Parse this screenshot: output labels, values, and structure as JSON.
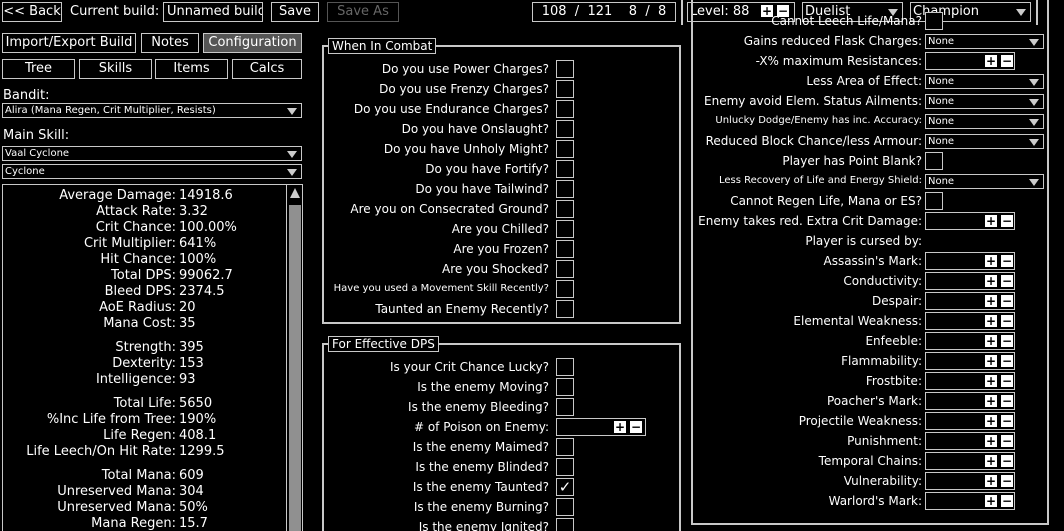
{
  "topbar": {
    "back": "<< Back",
    "current_build_label": "Current build:",
    "build_name": "Unnamed build",
    "save": "Save",
    "save_as": "Save As",
    "points": "108  /  121    8  /  8",
    "level": "Level: 88",
    "class": "Duelist",
    "ascendancy": "Champion"
  },
  "left": {
    "tabs": [
      "Import/Export Build",
      "Notes",
      "Configuration"
    ],
    "subtabs": [
      "Tree",
      "Skills",
      "Items",
      "Calcs"
    ],
    "bandit_label": "Bandit:",
    "bandit_value": "Alira (Mana Regen, Crit Multiplier, Resists)",
    "main_skill_label": "Main Skill:",
    "main_skill": "Vaal Cyclone",
    "sub_skill": "Cyclone",
    "stats": [
      {
        "k": "Average Damage:",
        "v": "14918.6"
      },
      {
        "k": "Attack Rate:",
        "v": "3.32"
      },
      {
        "k": "Crit Chance:",
        "v": "100.00%"
      },
      {
        "k": "Crit Multiplier:",
        "v": "641%"
      },
      {
        "k": "Hit Chance:",
        "v": "100%"
      },
      {
        "k": "Total DPS:",
        "v": "99062.7"
      },
      {
        "k": "Bleed DPS:",
        "v": "2374.5"
      },
      {
        "k": "AoE Radius:",
        "v": "20"
      },
      {
        "k": "Mana Cost:",
        "v": "35"
      },
      {
        "k": "Strength:",
        "v": "395"
      },
      {
        "k": "Dexterity:",
        "v": "153"
      },
      {
        "k": "Intelligence:",
        "v": "93"
      },
      {
        "k": "Total Life:",
        "v": "5650"
      },
      {
        "k": "%Inc Life from Tree:",
        "v": "190%"
      },
      {
        "k": "Life Regen:",
        "v": "408.1"
      },
      {
        "k": "Life Leech/On Hit Rate:",
        "v": "1299.5"
      },
      {
        "k": "Total Mana:",
        "v": "609"
      },
      {
        "k": "Unreserved Mana:",
        "v": "304"
      },
      {
        "k": "Unreserved Mana:",
        "v": "50%"
      },
      {
        "k": "Mana Regen:",
        "v": "15.7"
      }
    ]
  },
  "combat": {
    "title": "When In Combat",
    "items": [
      "Do you use Power Charges?",
      "Do you use Frenzy Charges?",
      "Do you use Endurance Charges?",
      "Do you have Onslaught?",
      "Do you have Unholy Might?",
      "Do you have Fortify?",
      "Do you have Tailwind?",
      "Are you on Consecrated Ground?",
      "Are you Chilled?",
      "Are you Frozen?",
      "Are you Shocked?",
      "Have you used a Movement Skill Recently?",
      "Taunted an Enemy Recently?"
    ]
  },
  "dps": {
    "title": "For Effective DPS",
    "items": [
      "Is your Crit Chance Lucky?",
      "Is the enemy Moving?",
      "Is the enemy Bleeding?",
      "# of Poison on Enemy:",
      "Is the enemy Maimed?",
      "Is the enemy Blinded?",
      "Is the enemy Taunted?",
      "Is the enemy Burning?",
      "Is the enemy Ignited?"
    ],
    "taunted_check": "✓"
  },
  "right": {
    "items": [
      {
        "label": "Cannot Leech Life/Mana?",
        "type": "cb"
      },
      {
        "label": "Gains reduced Flask Charges:",
        "type": "dd",
        "value": "None"
      },
      {
        "label": "-X% maximum Resistances:",
        "type": "num"
      },
      {
        "label": "Less Area of Effect:",
        "type": "dd",
        "value": "None"
      },
      {
        "label": "Enemy avoid Elem. Status Ailments:",
        "type": "dd",
        "value": "None"
      },
      {
        "label": "Unlucky Dodge/Enemy has inc. Accuracy:",
        "type": "dd",
        "value": "None",
        "small": true
      },
      {
        "label": "Reduced Block Chance/less Armour:",
        "type": "dd",
        "value": "None"
      },
      {
        "label": "Player has Point Blank?",
        "type": "cb"
      },
      {
        "label": "Less Recovery of Life and Energy Shield:",
        "type": "dd",
        "value": "None",
        "small": true
      },
      {
        "label": "Cannot Regen Life, Mana or ES?",
        "type": "cb"
      },
      {
        "label": "Enemy takes red. Extra Crit Damage:",
        "type": "num"
      },
      {
        "label": "Player is cursed by:",
        "type": "none"
      },
      {
        "label": "Assassin's Mark:",
        "type": "num"
      },
      {
        "label": "Conductivity:",
        "type": "num"
      },
      {
        "label": "Despair:",
        "type": "num"
      },
      {
        "label": "Elemental Weakness:",
        "type": "num"
      },
      {
        "label": "Enfeeble:",
        "type": "num"
      },
      {
        "label": "Flammability:",
        "type": "num"
      },
      {
        "label": "Frostbite:",
        "type": "num"
      },
      {
        "label": "Poacher's Mark:",
        "type": "num"
      },
      {
        "label": "Projectile Weakness:",
        "type": "num"
      },
      {
        "label": "Punishment:",
        "type": "num"
      },
      {
        "label": "Temporal Chains:",
        "type": "num"
      },
      {
        "label": "Vulnerability:",
        "type": "num"
      },
      {
        "label": "Warlord's Mark:",
        "type": "num"
      }
    ]
  },
  "glyphs": {
    "plus": "+",
    "minus": "−"
  }
}
